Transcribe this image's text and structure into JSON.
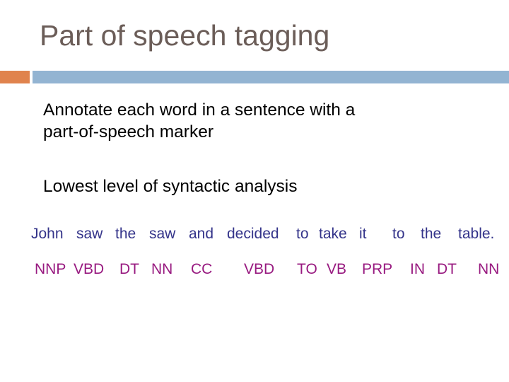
{
  "slide": {
    "title": "Part of speech tagging",
    "bullets": [
      "Annotate each word in a sentence with a part-of-speech marker",
      "Lowest level of syntactic analysis"
    ],
    "colors": {
      "title": "#6b5d58",
      "accent_orange": "#e0834d",
      "accent_blue": "#93b4d2",
      "words": "#34348a",
      "tags": "#981a80"
    },
    "example": {
      "words": [
        "John",
        "saw",
        "the",
        "saw",
        "and",
        "decided",
        "to",
        "take",
        "it",
        "to",
        "the",
        "table."
      ],
      "tags": [
        "NNP",
        "VBD",
        "DT",
        "NN",
        "CC",
        "VBD",
        "TO",
        "VB",
        "PRP",
        "IN",
        "DT",
        "NN"
      ]
    }
  }
}
